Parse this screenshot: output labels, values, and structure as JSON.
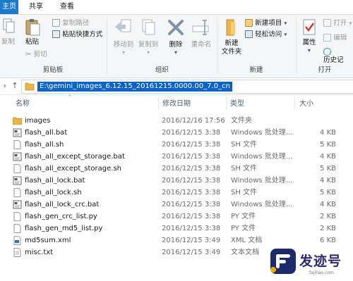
{
  "tabs": [
    {
      "label": "主页",
      "active": true
    },
    {
      "label": "共享",
      "active": false
    },
    {
      "label": "查看",
      "active": false
    }
  ],
  "ribbon": {
    "clipboard": {
      "group_label": "剪贴板",
      "copy": "复制",
      "paste": "粘贴",
      "copy_path": "复制路径",
      "paste_shortcut": "粘贴快捷方式",
      "cut": "剪切"
    },
    "organize": {
      "group_label": "组织",
      "move_to": "移动到",
      "copy_to": "复制到",
      "delete": "删除",
      "rename": "重命名"
    },
    "new": {
      "group_label": "新建",
      "new_folder_line1": "新建",
      "new_folder_line2": "文件夹",
      "new_item": "新建项目",
      "easy_access": "轻松访问"
    },
    "open": {
      "group_label": "打开",
      "properties": "属性",
      "open": "打开",
      "edit": "编辑",
      "history": "历史记"
    }
  },
  "address": {
    "path": "E:\\gemini_images_6.12.15_20161215.0000.00_7.0_cn"
  },
  "columns": {
    "name": "名称",
    "date": "修改日期",
    "type": "类型",
    "size": "大小"
  },
  "files": [
    {
      "name": "images",
      "date": "2016/12/16 17:56",
      "type": "文件夹",
      "size": "",
      "icon": "folder-icon"
    },
    {
      "name": "flash_all.bat",
      "date": "2016/12/15 3:38",
      "type": "Windows 批处理...",
      "size": "4 KB",
      "icon": "batch-file-icon"
    },
    {
      "name": "flash_all.sh",
      "date": "2016/12/15 3:38",
      "type": "SH 文件",
      "size": "5 KB",
      "icon": "file-icon"
    },
    {
      "name": "flash_all_except_storage.bat",
      "date": "2016/12/15 3:38",
      "type": "Windows 批处理...",
      "size": "4 KB",
      "icon": "batch-file-icon"
    },
    {
      "name": "flash_all_except_storage.sh",
      "date": "2016/12/15 3:38",
      "type": "SH 文件",
      "size": "5 KB",
      "icon": "file-icon"
    },
    {
      "name": "flash_all_lock.bat",
      "date": "2016/12/15 3:38",
      "type": "Windows 批处理...",
      "size": "4 KB",
      "icon": "batch-file-icon"
    },
    {
      "name": "flash_all_lock.sh",
      "date": "2016/12/15 3:38",
      "type": "SH 文件",
      "size": "5 KB",
      "icon": "file-icon"
    },
    {
      "name": "flash_all_lock_crc.bat",
      "date": "2016/12/15 3:38",
      "type": "Windows 批处理...",
      "size": "4 KB",
      "icon": "batch-file-icon"
    },
    {
      "name": "flash_gen_crc_list.py",
      "date": "2016/12/15 3:38",
      "type": "PY 文件",
      "size": "2 KB",
      "icon": "file-icon"
    },
    {
      "name": "flash_gen_md5_list.py",
      "date": "2016/12/15 3:38",
      "type": "PY 文件",
      "size": "2 KB",
      "icon": "file-icon"
    },
    {
      "name": "md5sum.xml",
      "date": "2016/12/15 3:49",
      "type": "XML 文档",
      "size": "6 KB",
      "icon": "xml-file-icon"
    },
    {
      "name": "misc.txt",
      "date": "2016/12/15 3:49",
      "type": "文本文档",
      "size": "",
      "icon": "text-file-icon"
    }
  ],
  "watermark": {
    "text": "发迹号",
    "url": "fajihao.com"
  },
  "colors": {
    "accent": "#1979ca",
    "selection": "#0a64c8",
    "folder": "#e8b64a",
    "delete_red": "#d13b2f"
  }
}
